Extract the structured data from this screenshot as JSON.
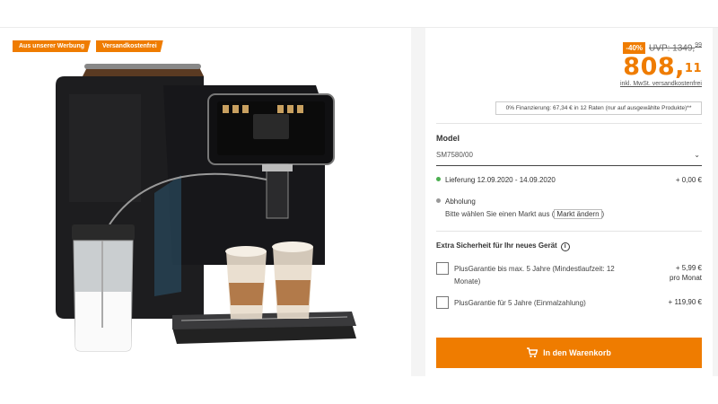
{
  "badges": [
    "Aus unserer Werbung",
    "Versandkostenfrei"
  ],
  "price": {
    "discount": "-40%",
    "uvp_label": "UVP: 1349,",
    "uvp_cents": "99",
    "main": "808,",
    "cents": "11",
    "vat": "inkl. MwSt. versandkostenfrei"
  },
  "finance": "0% Finanzierung: 67,34 € in 12 Raten (nur auf ausgewählte Produkte)**",
  "model": {
    "label": "Model",
    "value": "SM7580/00"
  },
  "delivery": {
    "label": "Lieferung 12.09.2020 - 14.09.2020",
    "cost": "+ 0,00 €",
    "color": "#4caf50"
  },
  "pickup": {
    "label": "Abholung",
    "text": "Bitte wählen Sie einen Markt aus",
    "link": "Markt ändern",
    "color": "#999999"
  },
  "extra": {
    "title": "Extra Sicherheit für Ihr neues Gerät",
    "options": [
      {
        "text": "PlusGarantie bis max. 5 Jahre (Mindestlaufzeit: 12 Monate)",
        "price": "+ 5,99 €",
        "price2": "pro Monat"
      },
      {
        "text": "PlusGarantie für 5 Jahre (Einmalzahlung)",
        "price": "+ 119,90 €",
        "price2": ""
      }
    ]
  },
  "cart_button": "In den Warenkorb",
  "accent": "#ef7c00"
}
